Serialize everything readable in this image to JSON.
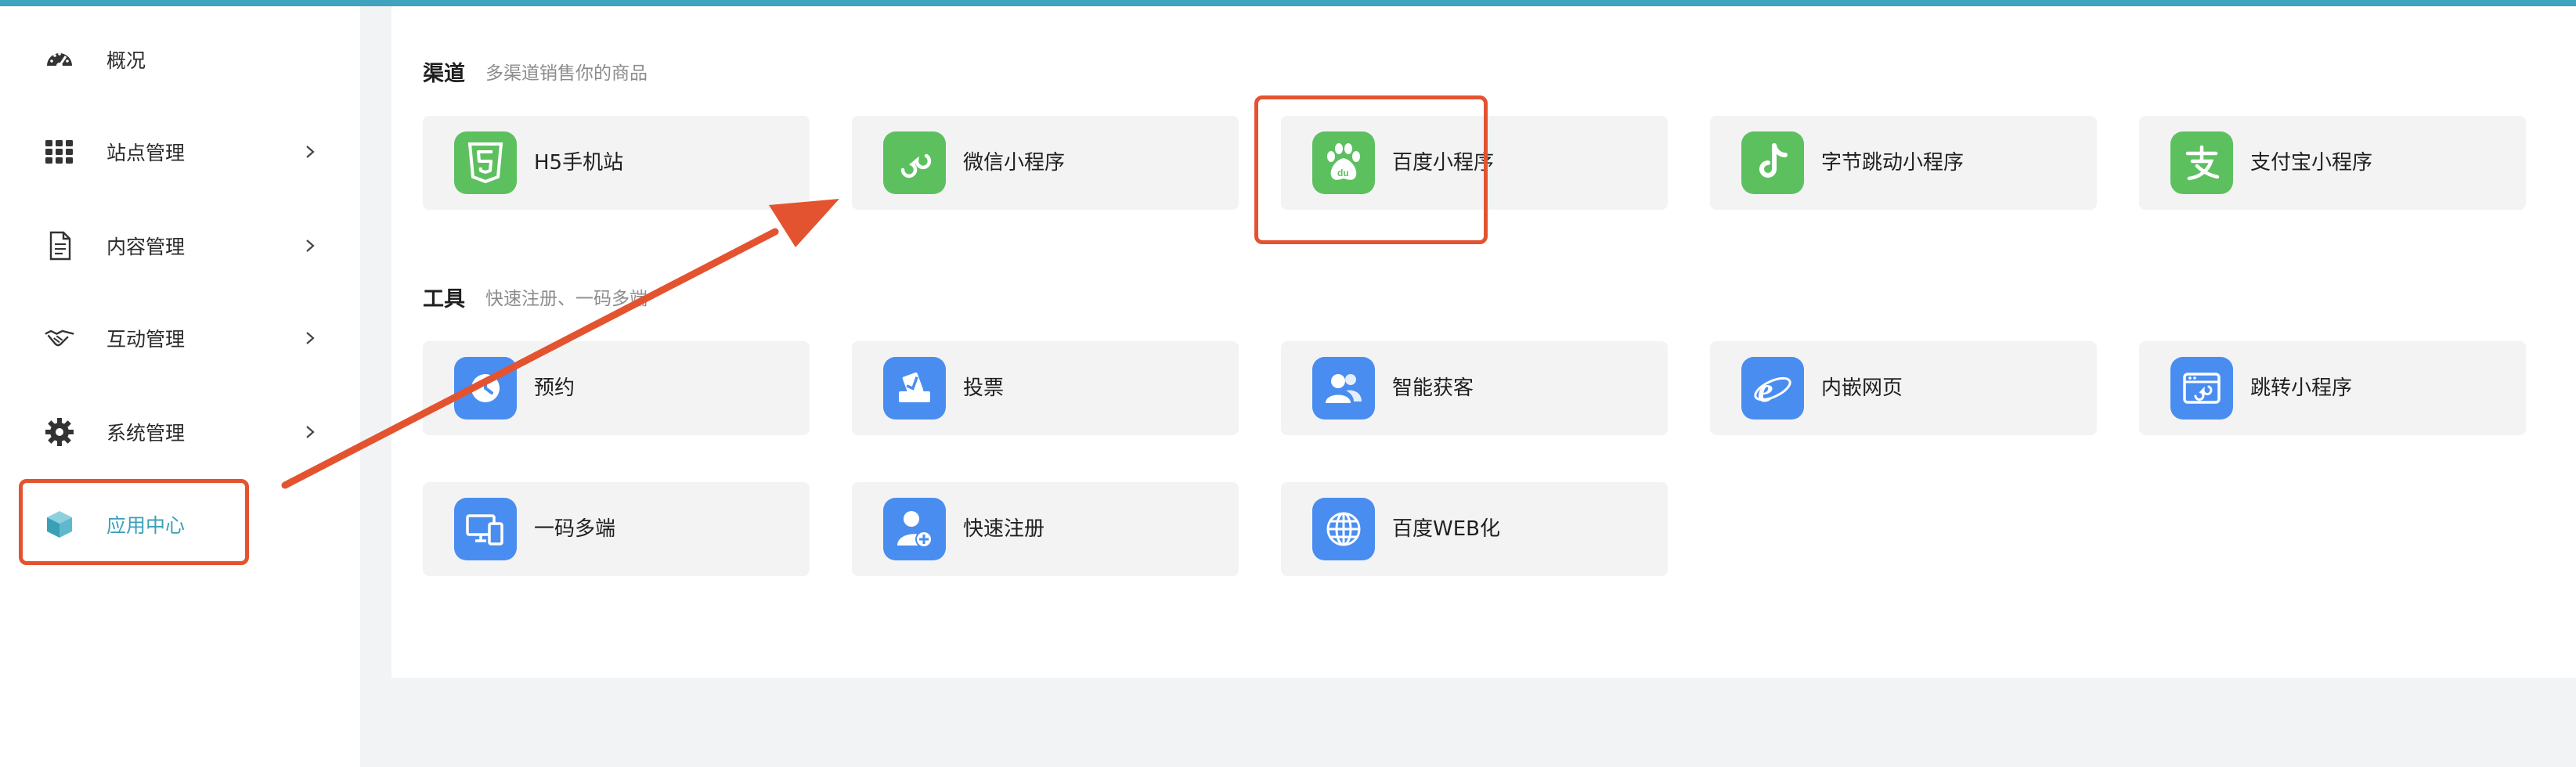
{
  "colors": {
    "accent": "#3fa3bd",
    "active_text": "#3aa0b8",
    "annotation": "#e4532f",
    "channel_icon": "#5dc05f",
    "tool_icon": "#4a8df0"
  },
  "sidebar": {
    "items": [
      {
        "label": "概况",
        "icon": "dashboard-icon",
        "has_arrow": false
      },
      {
        "label": "站点管理",
        "icon": "grid-icon",
        "has_arrow": true
      },
      {
        "label": "内容管理",
        "icon": "document-icon",
        "has_arrow": true
      },
      {
        "label": "互动管理",
        "icon": "handshake-icon",
        "has_arrow": true
      },
      {
        "label": "系统管理",
        "icon": "gear-icon",
        "has_arrow": true
      },
      {
        "label": "应用中心",
        "icon": "cube-icon",
        "has_arrow": false,
        "active": true
      }
    ]
  },
  "channels": {
    "title": "渠道",
    "subtitle": "多渠道销售你的商品",
    "items": [
      {
        "label": "H5手机站",
        "icon": "html5-icon"
      },
      {
        "label": "微信小程序",
        "icon": "wechat-miniprogram-icon"
      },
      {
        "label": "百度小程序",
        "icon": "baidu-icon"
      },
      {
        "label": "字节跳动小程序",
        "icon": "tiktok-icon"
      },
      {
        "label": "支付宝小程序",
        "icon": "alipay-icon"
      }
    ]
  },
  "tools": {
    "title": "工具",
    "subtitle": "快速注册、一码多端",
    "items": [
      {
        "label": "预约",
        "icon": "clock-icon"
      },
      {
        "label": "投票",
        "icon": "ballot-icon"
      },
      {
        "label": "智能获客",
        "icon": "users-icon"
      },
      {
        "label": "内嵌网页",
        "icon": "ie-icon"
      },
      {
        "label": "跳转小程序",
        "icon": "link-window-icon"
      },
      {
        "label": "一码多端",
        "icon": "devices-icon"
      },
      {
        "label": "快速注册",
        "icon": "user-add-icon"
      },
      {
        "label": "百度WEB化",
        "icon": "globe-icon"
      }
    ]
  }
}
